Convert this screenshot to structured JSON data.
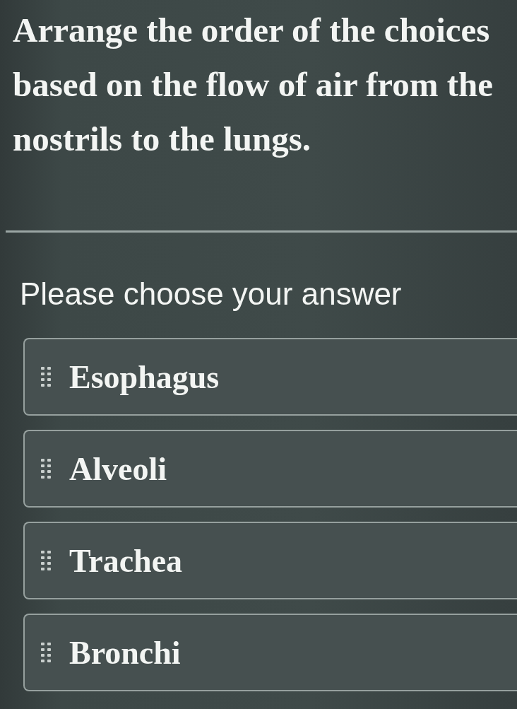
{
  "question": "Arrange the order of the choices based on the flow of air from the nostrils to the lungs.",
  "prompt": "Please choose your answer",
  "choices": [
    {
      "label": "Esophagus"
    },
    {
      "label": "Alveoli"
    },
    {
      "label": "Trachea"
    },
    {
      "label": "Bronchi"
    }
  ]
}
